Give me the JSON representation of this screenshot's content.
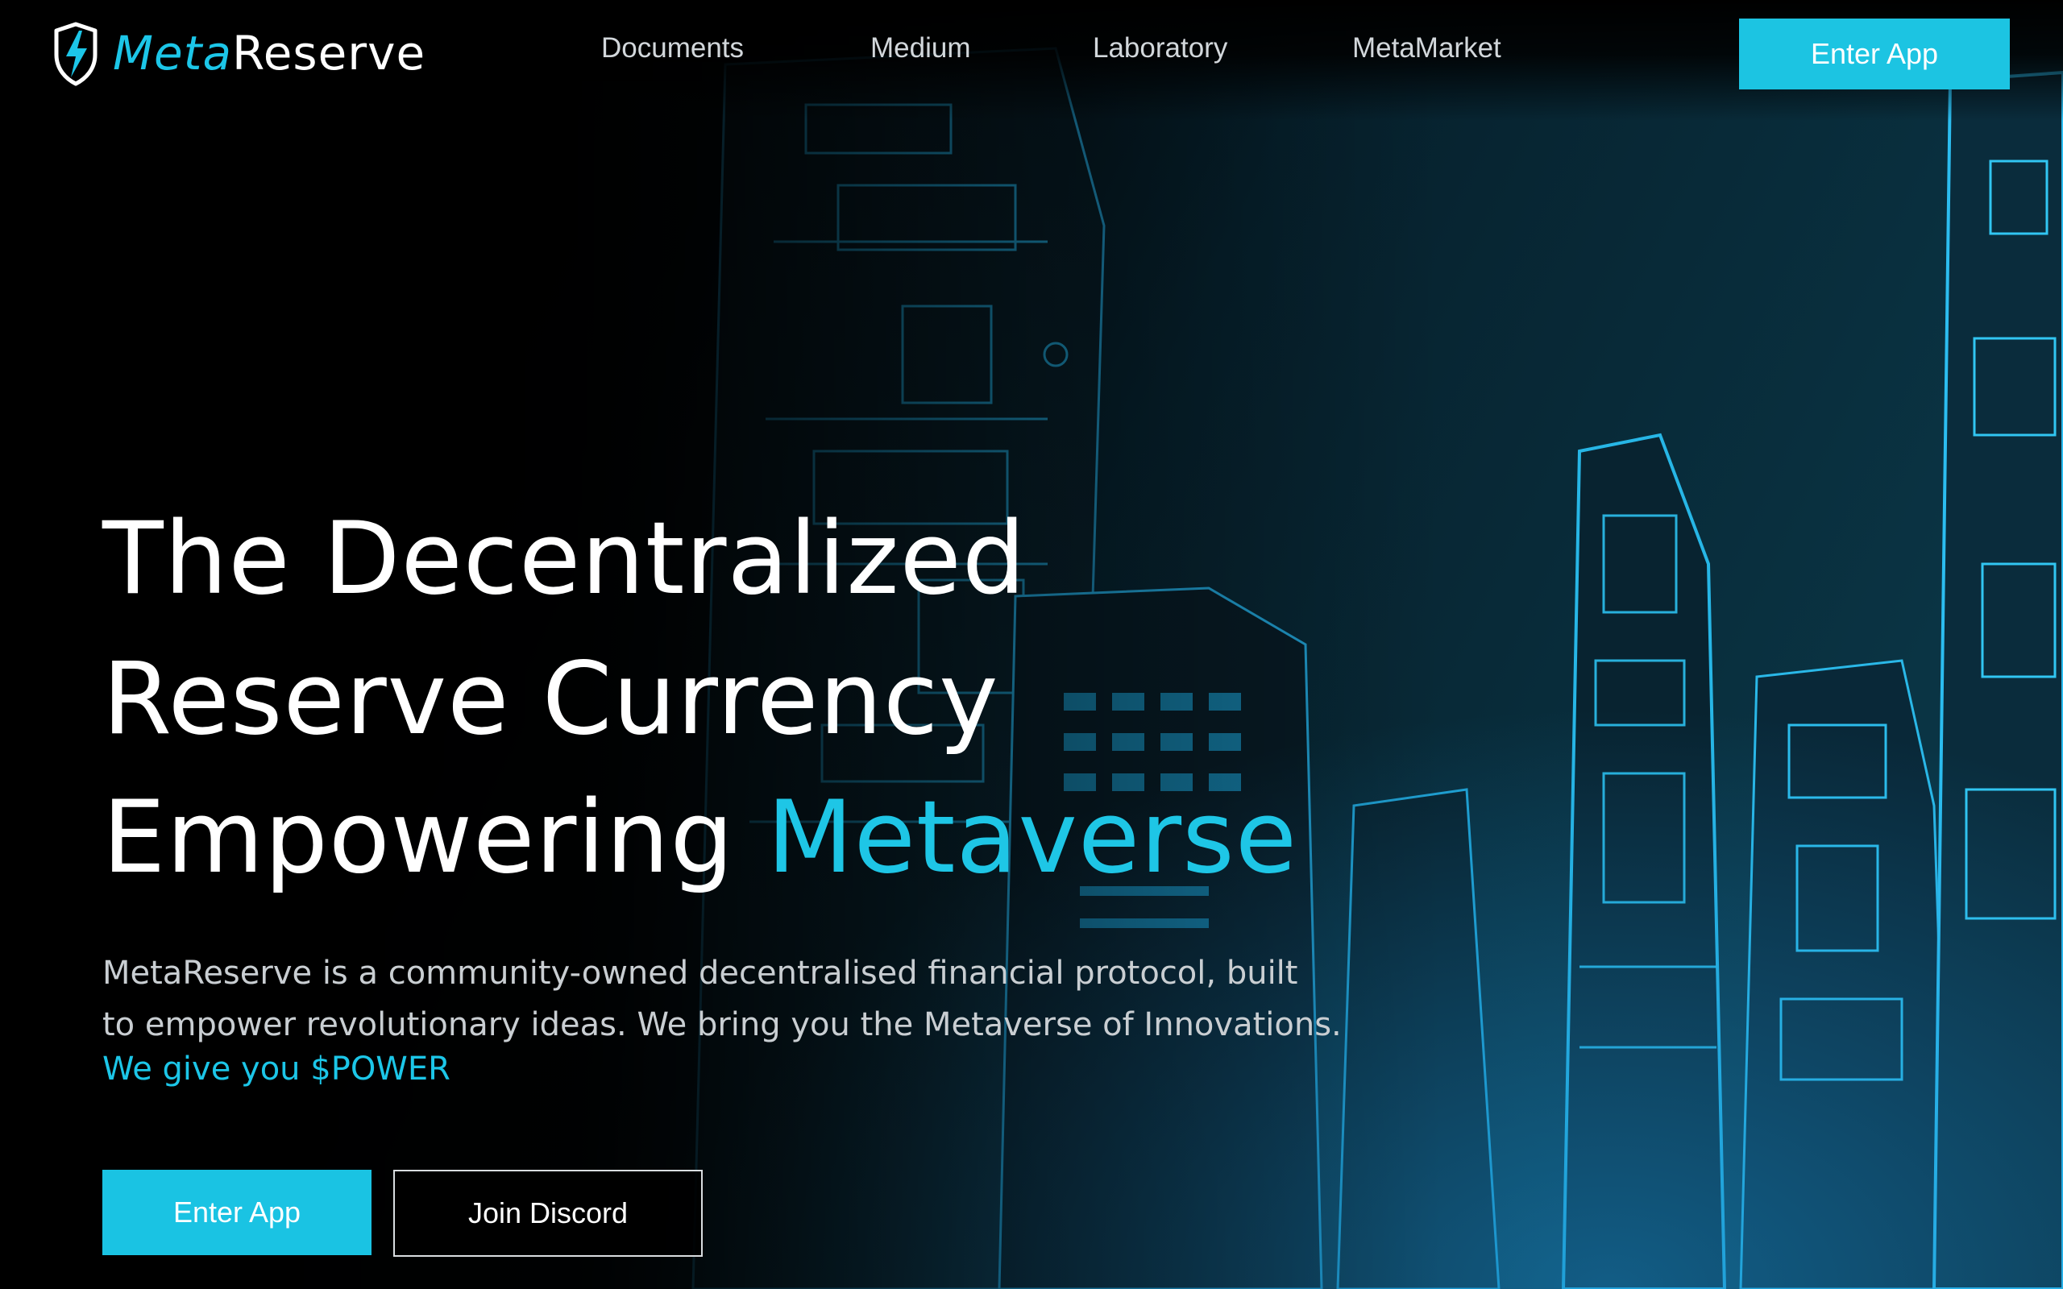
{
  "brand": {
    "name_part1": "Meta",
    "name_part2": "Reserve",
    "accent_color": "#1cc6e8",
    "icon": "shield-lightning-icon"
  },
  "nav": {
    "items": [
      {
        "label": "Documents"
      },
      {
        "label": "Medium"
      },
      {
        "label": "Laboratory"
      },
      {
        "label": "MetaMarket"
      }
    ],
    "cta_label": "Enter App"
  },
  "hero": {
    "line1": "The Decentralized",
    "line2": "Reserve Currency",
    "line3_prefix": "Empowering ",
    "line3_accent": "Metaverse",
    "description_line1": "MetaReserve is a community-owned decentralised financial protocol, built",
    "description_line2": "to empower revolutionary ideas. We bring you the Metaverse of Innovations.",
    "tagline": "We give you $POWER",
    "primary_button": "Enter App",
    "secondary_button": "Join Discord"
  },
  "colors": {
    "background": "#000000",
    "accent": "#1cc6e8",
    "text": "#ffffff",
    "muted_text": "#c9ced2"
  }
}
